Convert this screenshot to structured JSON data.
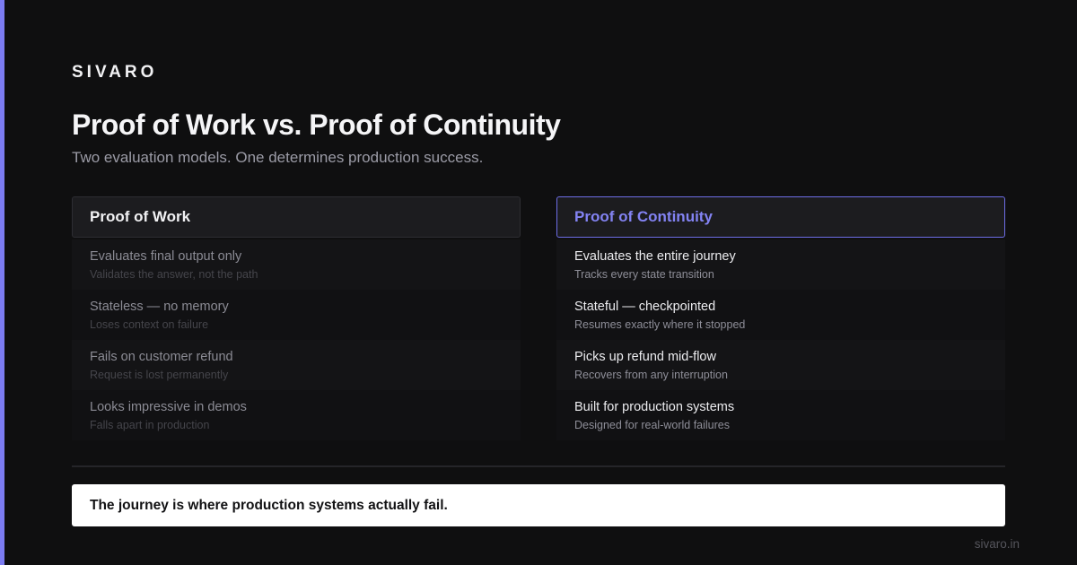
{
  "brand": "SIVARO",
  "title": "Proof of Work vs. Proof of Continuity",
  "subtitle": "Two evaluation models. One determines production success.",
  "columns": [
    {
      "heading": "Proof of Work",
      "rows": [
        {
          "main": "Evaluates final output only",
          "sub": "Validates the answer, not the path"
        },
        {
          "main": "Stateless — no memory",
          "sub": "Loses context on failure"
        },
        {
          "main": "Fails on customer refund",
          "sub": "Request is lost permanently"
        },
        {
          "main": "Looks impressive in demos",
          "sub": "Falls apart in production"
        }
      ]
    },
    {
      "heading": "Proof of Continuity",
      "rows": [
        {
          "main": "Evaluates the entire journey",
          "sub": "Tracks every state transition"
        },
        {
          "main": "Stateful — checkpointed",
          "sub": "Resumes exactly where it stopped"
        },
        {
          "main": "Picks up refund mid-flow",
          "sub": "Recovers from any interruption"
        },
        {
          "main": "Built for production systems",
          "sub": "Designed for real-world failures"
        }
      ]
    }
  ],
  "callout": "The journey is where production systems actually fail.",
  "footer_url": "sivaro.in",
  "colors": {
    "background": "#0f0f10",
    "accent": "#7c7cf2",
    "highlight_text": "#8383f3",
    "callout_background": "#ffffff"
  }
}
